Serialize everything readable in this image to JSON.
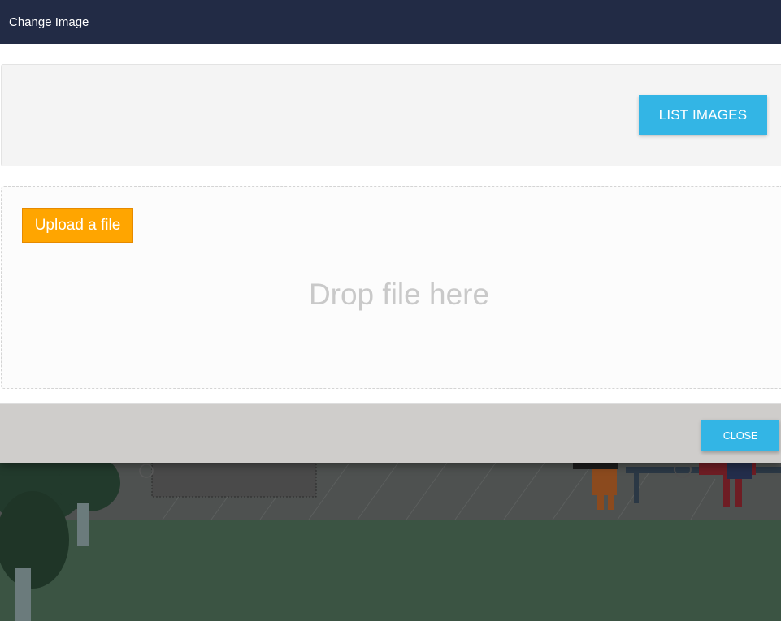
{
  "modal": {
    "title": "Change Image",
    "list_images_label": "LIST IMAGES",
    "upload_label": "Upload a file",
    "drop_text": "Drop file here",
    "close_label": "CLOSE"
  },
  "colors": {
    "header_bg": "#222b45",
    "accent_blue": "#33b5e5",
    "upload_orange": "#ffa500",
    "footer_bg": "#cfcdcb",
    "backdrop_ground": "#3b5443"
  }
}
